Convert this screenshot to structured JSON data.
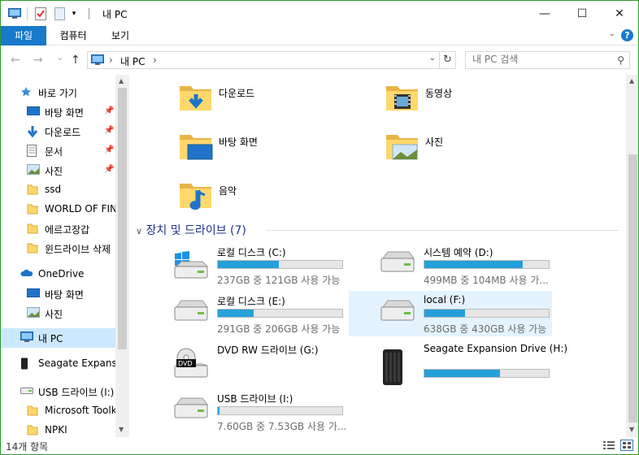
{
  "window": {
    "title": "내 PC",
    "brand_color": "#1979ca",
    "controls": {
      "minimize": "—",
      "maximize": "☐",
      "close": "✕"
    }
  },
  "ribbon": {
    "tabs": [
      {
        "label": "파일",
        "active": true
      },
      {
        "label": "컴퓨터"
      },
      {
        "label": "보기"
      }
    ],
    "help": "?"
  },
  "nav": {
    "back": "←",
    "forward": "→",
    "recent": "⌄",
    "up": "↑",
    "address_path": [
      "내 PC"
    ],
    "refresh": "↻",
    "search_placeholder": "내 PC 검색"
  },
  "sidebar": {
    "items": [
      {
        "label": "바로 가기",
        "icon": "star-icon",
        "indent": 1,
        "pinned": false
      },
      {
        "label": "바탕 화면",
        "icon": "desktop-icon",
        "indent": 2,
        "pinned": true
      },
      {
        "label": "다운로드",
        "icon": "download-icon",
        "indent": 2,
        "pinned": true
      },
      {
        "label": "문서",
        "icon": "document-icon",
        "indent": 2,
        "pinned": true
      },
      {
        "label": "사진",
        "icon": "pictures-icon",
        "indent": 2,
        "pinned": true
      },
      {
        "label": "ssd",
        "icon": "folder-icon",
        "indent": 2,
        "pinned": false
      },
      {
        "label": "WORLD OF FINA",
        "icon": "folder-icon",
        "indent": 2,
        "pinned": false
      },
      {
        "label": "에르고장갑",
        "icon": "folder-icon",
        "indent": 2,
        "pinned": false
      },
      {
        "label": "윈드라이브 삭제",
        "icon": "folder-icon",
        "indent": 2,
        "pinned": false
      },
      {
        "label": "OneDrive",
        "icon": "onedrive-icon",
        "indent": 1,
        "pinned": false
      },
      {
        "label": "바탕 화면",
        "icon": "desktop-icon",
        "indent": 2,
        "pinned": false
      },
      {
        "label": "사진",
        "icon": "pictures-icon",
        "indent": 2,
        "pinned": false
      },
      {
        "label": "내 PC",
        "icon": "pc-icon",
        "indent": 1,
        "pinned": false,
        "selected": true
      },
      {
        "label": "Seagate Expansio",
        "icon": "external-drive-icon",
        "indent": 1,
        "pinned": false
      },
      {
        "label": "USB 드라이브 (I:)",
        "icon": "usb-drive-icon",
        "indent": 1,
        "pinned": false
      },
      {
        "label": "Microsoft Toolki",
        "icon": "folder-icon",
        "indent": 2,
        "pinned": false
      },
      {
        "label": "NPKI",
        "icon": "folder-icon",
        "indent": 2,
        "pinned": false
      }
    ]
  },
  "folders": [
    {
      "label": "다운로드",
      "icon": "downloads-folder-icon"
    },
    {
      "label": "동영상",
      "icon": "videos-folder-icon"
    },
    {
      "label": "바탕 화면",
      "icon": "desktop-folder-icon"
    },
    {
      "label": "사진",
      "icon": "pictures-folder-icon"
    },
    {
      "label": "음악",
      "icon": "music-folder-icon"
    }
  ],
  "devices_group": {
    "label": "장치 및 드라이브 (7)"
  },
  "drives": [
    {
      "name": "로컬 디스크 (C:)",
      "free": "237GB 중 121GB 사용 가능",
      "used_fraction": 0.49,
      "icon": "windows-drive-icon",
      "selected": false
    },
    {
      "name": "시스템 예약 (D:)",
      "free": "499MB 중 104MB 사용 가...",
      "used_fraction": 0.79,
      "icon": "hard-drive-icon",
      "selected": false
    },
    {
      "name": "로컬 디스크 (E:)",
      "free": "291GB 중 206GB 사용 가능",
      "used_fraction": 0.29,
      "icon": "hard-drive-icon",
      "selected": false
    },
    {
      "name": "local (F:)",
      "free": "638GB 중 430GB 사용 가능",
      "used_fraction": 0.33,
      "icon": "hard-drive-icon",
      "selected": true
    },
    {
      "name": "DVD RW 드라이브 (G:)",
      "free": "",
      "used_fraction": null,
      "icon": "dvd-drive-icon",
      "selected": false
    },
    {
      "name": "Seagate Expansion Drive (H:)",
      "free": "",
      "used_fraction": 0.61,
      "icon": "seagate-drive-icon",
      "selected": false
    },
    {
      "name": "USB 드라이브 (I:)",
      "free": "7.60GB 중 7.53GB 사용 가...",
      "used_fraction": 0.01,
      "icon": "usb-drive-icon",
      "selected": false
    }
  ],
  "status": {
    "item_count": "14개 항목"
  }
}
